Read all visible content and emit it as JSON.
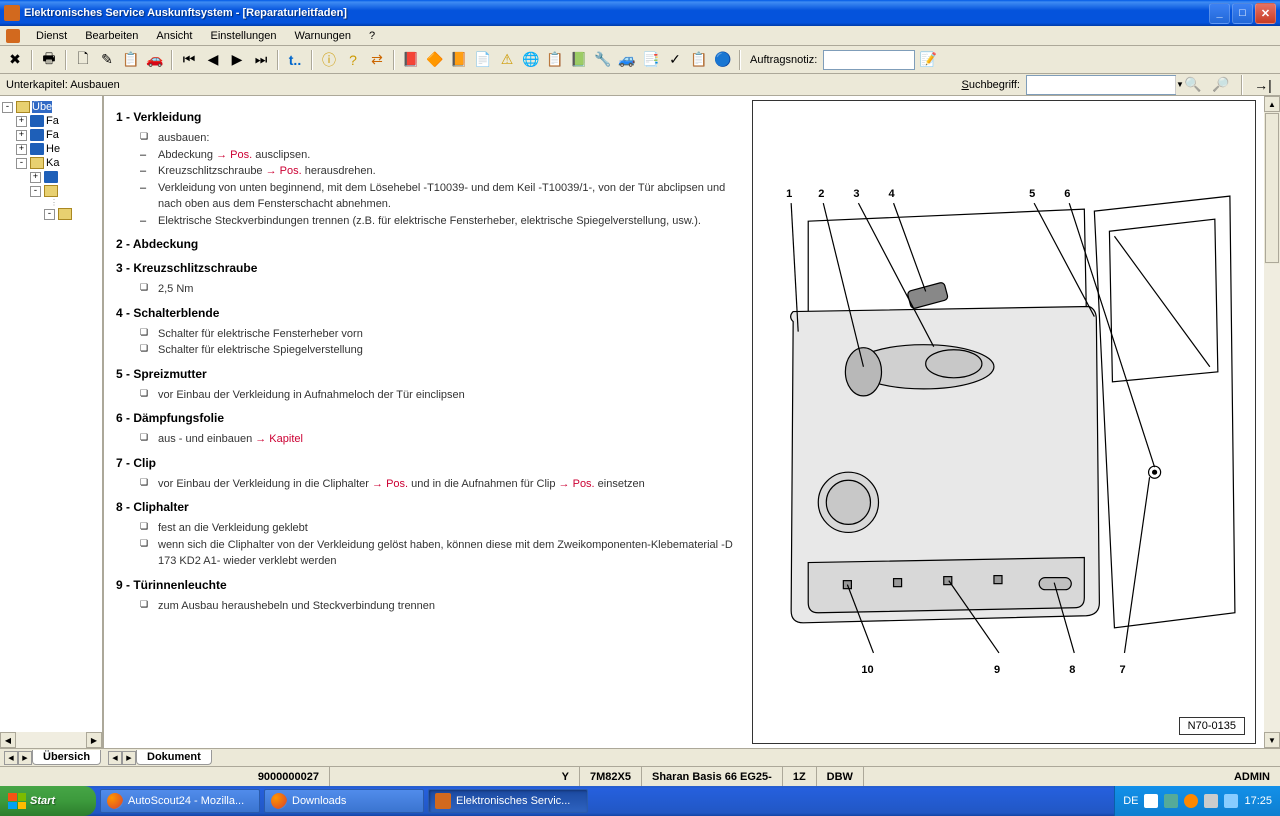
{
  "window": {
    "title": "Elektronisches Service Auskunftsystem - [Reparaturleitfaden]"
  },
  "menu": {
    "dienst": "Dienst",
    "bearbeiten": "Bearbeiten",
    "ansicht": "Ansicht",
    "einstellungen": "Einstellungen",
    "warnungen": "Warnungen",
    "help": "?"
  },
  "toolbar": {
    "auftragsnotiz": "Auftragsnotiz:"
  },
  "subheader": {
    "left": "Unterkapitel: Ausbauen",
    "search_label": "Suchbegriff:"
  },
  "tree": {
    "root": "Übe",
    "items": [
      "Fa",
      "Fa",
      "He",
      "Ka"
    ]
  },
  "document": {
    "s1": {
      "title": "1 -  Verkleidung",
      "i1": "ausbauen:",
      "i2a": "Abdeckung ",
      "i2b": "→ Pos.",
      "i2c": " ausclipsen.",
      "i3a": "Kreuzschlitzschraube ",
      "i3b": "→ Pos.",
      "i3c": " herausdrehen.",
      "i4": "Verkleidung von unten beginnend, mit dem Lösehebel -T10039- und dem Keil -T10039/1-, von der Tür abclipsen und nach oben aus dem Fensterschacht abnehmen.",
      "i5": "Elektrische Steckverbindungen trennen (z.B. für elektrische Fensterheber, elektrische Spiegelverstellung, usw.)."
    },
    "s2": {
      "title": "2 -  Abdeckung"
    },
    "s3": {
      "title": "3 -  Kreuzschlitzschraube",
      "i1": "2,5 Nm"
    },
    "s4": {
      "title": "4 -  Schalterblende",
      "i1": "Schalter für elektrische Fensterheber vorn",
      "i2": "Schalter für elektrische Spiegelverstellung"
    },
    "s5": {
      "title": "5 -  Spreizmutter",
      "i1": "vor Einbau der Verkleidung in Aufnahmeloch der Tür einclipsen"
    },
    "s6": {
      "title": "6 -  Dämpfungsfolie",
      "i1a": "aus - und einbauen ",
      "i1b": "→ Kapitel"
    },
    "s7": {
      "title": "7 -  Clip",
      "i1a": "vor Einbau der Verkleidung in die Cliphalter ",
      "i1b": "→ Pos.",
      "i1c": " und in die Aufnahmen für Clip ",
      "i1d": "→ Pos.",
      "i1e": " einsetzen"
    },
    "s8": {
      "title": "8 -  Cliphalter",
      "i1": "fest an die Verkleidung geklebt",
      "i2": "wenn sich die Cliphalter von der Verkleidung gelöst haben, können diese mit dem Zweikomponenten-Klebematerial -D 173 KD2 A1- wieder verklebt werden"
    },
    "s9": {
      "title": "9 -  Türinnenleuchte",
      "i1": "zum Ausbau heraushebeln und Steckverbindung trennen"
    }
  },
  "diagram": {
    "label": "N70-0135",
    "nums_top": [
      "1",
      "2",
      "3",
      "4",
      "5",
      "6"
    ],
    "nums_bot": [
      "10",
      "9",
      "8",
      "7"
    ]
  },
  "tabs": {
    "left": "Übersich",
    "right": "Dokument"
  },
  "status": {
    "num": "9000000027",
    "y": "Y",
    "code": "7M82X5",
    "model": "Sharan Basis 66 EG25-",
    "z": "1Z",
    "dbw": "DBW",
    "admin": "ADMIN"
  },
  "taskbar": {
    "start": "Start",
    "t1": "AutoScout24 - Mozilla...",
    "t2": "Downloads",
    "t3": "Elektronisches Servic...",
    "lang": "DE",
    "time": "17:25"
  }
}
